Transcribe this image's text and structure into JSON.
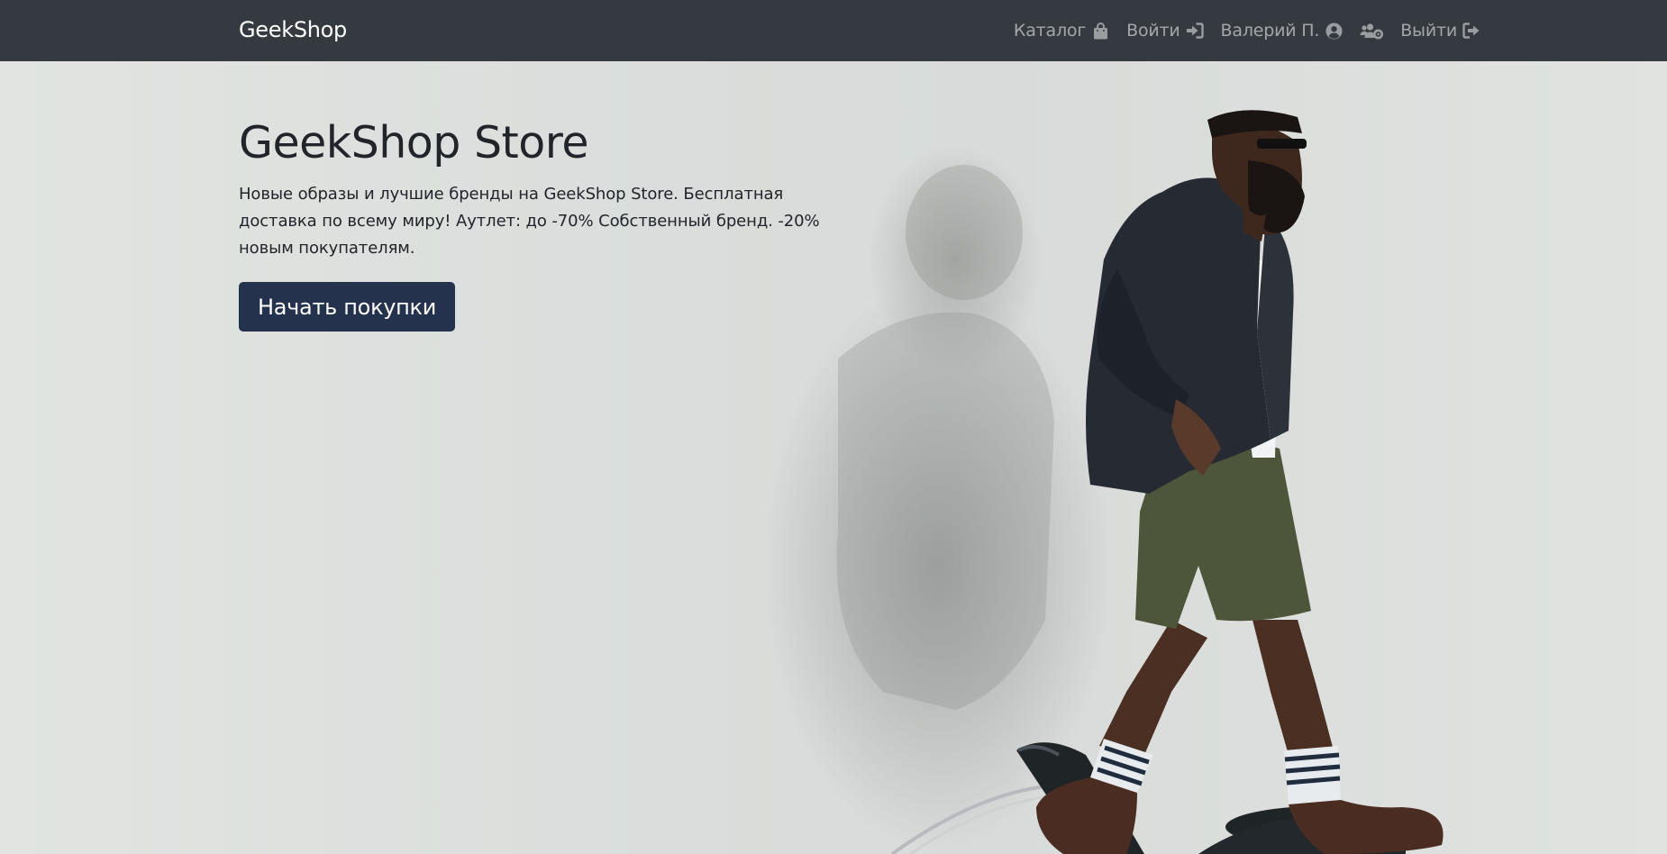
{
  "navbar": {
    "brand": "GeekShop",
    "links": [
      {
        "label": "Каталог",
        "icon": "shopping-bag-icon"
      },
      {
        "label": "Войти",
        "icon": "sign-in-icon"
      },
      {
        "label": "Валерий П.",
        "icon": "user-circle-icon"
      },
      {
        "label": "",
        "icon": "users-cog-icon"
      },
      {
        "label": "Выйти",
        "icon": "sign-out-icon"
      }
    ]
  },
  "hero": {
    "title": "GeekShop Store",
    "text": "Новые образы и лучшие бренды на GeekShop Store. Бесплатная доставка по всему миру! Аутлет: до -70% Собственный бренд. -20% новым покупателям.",
    "cta_label": "Начать покупки"
  },
  "colors": {
    "navbar_bg": "#343a40",
    "nav_link": "rgba(255,255,255,0.55)",
    "cta_bg": "#24324d",
    "hero_bg": "#dfe2df"
  }
}
